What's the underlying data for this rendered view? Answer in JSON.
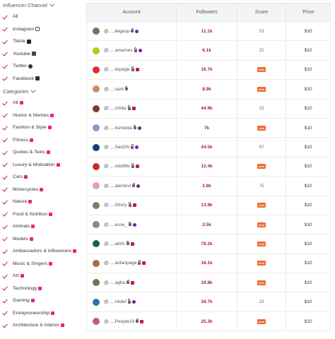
{
  "sidebar": {
    "influencer_channel": {
      "title": "Influencer Channel",
      "items": [
        {
          "label": "All",
          "icon": ""
        },
        {
          "label": "Instagram",
          "icon": "instagram-icon"
        },
        {
          "label": "Tiktok",
          "icon": "tiktok-icon"
        },
        {
          "label": "Youtube",
          "icon": "youtube-icon"
        },
        {
          "label": "Twitter",
          "icon": "twitter-icon"
        },
        {
          "label": "Facebook",
          "icon": "facebook-icon"
        }
      ]
    },
    "categories": {
      "title": "Categories",
      "items": [
        {
          "label": "All"
        },
        {
          "label": "Humor & Memes"
        },
        {
          "label": "Fashion & Style"
        },
        {
          "label": "Fitness"
        },
        {
          "label": "Quotes & Texts"
        },
        {
          "label": "Luxury & Motivation"
        },
        {
          "label": "Cars"
        },
        {
          "label": "Motorcycles"
        },
        {
          "label": "Nature"
        },
        {
          "label": "Food & Nutrition"
        },
        {
          "label": "Animals"
        },
        {
          "label": "Models"
        },
        {
          "label": "Ambassadors & Influencers"
        },
        {
          "label": "Music & Singers"
        },
        {
          "label": "Art"
        },
        {
          "label": "Technology"
        },
        {
          "label": "Gaming"
        },
        {
          "label": "Entrepreneurship"
        },
        {
          "label": "Architecture & Interior"
        }
      ]
    }
  },
  "table": {
    "headers": {
      "account": "Account",
      "followers": "Followers",
      "score": "Score",
      "price": "Price"
    },
    "new_label": "new",
    "rows": [
      {
        "account": "@.....llegasp",
        "followers": "11.1k",
        "score": "53",
        "price": "$10",
        "avatar_color": "#8a6a55",
        "icons": [
          "instagram",
          "twitter"
        ]
      },
      {
        "account": "@.....amemes",
        "followers": "6.1k",
        "score": "20",
        "price": "$10",
        "avatar_color": "#b8c820",
        "icons": [
          "instagram",
          "twitter"
        ]
      },
      {
        "account": "@.....itspage",
        "followers": "16.7k",
        "score": "new",
        "price": "$10",
        "avatar_color": "#d83030",
        "icons": [
          "instagram",
          "facebook"
        ]
      },
      {
        "account": "@.....sant",
        "followers": "8.9k",
        "score": "new",
        "price": "$10",
        "avatar_color": "#c09070",
        "icons": [
          "instagram"
        ]
      },
      {
        "account": "@.....rchita",
        "followers": "44.9k",
        "score": "25",
        "price": "$10",
        "avatar_color": "#704030",
        "icons": [
          "instagram",
          "facebook"
        ]
      },
      {
        "account": "@.....ksmedia",
        "followers": "7k",
        "score": "new",
        "price": "$10",
        "avatar_color": "#7a9fd0",
        "icons": [
          "instagram",
          "twitter"
        ]
      },
      {
        "account": "@.....SecDN",
        "followers": "44.5k",
        "score": "97",
        "price": "$10",
        "avatar_color": "#1a3a7a",
        "icons": [
          "instagram",
          "twitter"
        ]
      },
      {
        "account": "@.....ndoflife",
        "followers": "12.4k",
        "score": "new",
        "price": "$10",
        "avatar_color": "#c03030",
        "icons": [
          "instagram",
          "facebook"
        ]
      },
      {
        "account": "@.....alentino",
        "followers": "2.8k",
        "score": "75",
        "price": "$10",
        "avatar_color": "#e8a0b0",
        "icons": [
          "instagram",
          "twitter"
        ]
      },
      {
        "account": "@.....tStory",
        "followers": "13.8k",
        "score": "new",
        "price": "$10",
        "avatar_color": "#8a7a60",
        "icons": [
          "instagram",
          "facebook"
        ]
      },
      {
        "account": "@.....esse_",
        "followers": "2.5k",
        "score": "new",
        "price": "$10",
        "avatar_color": "#a08070",
        "icons": [
          "instagram",
          "twitter"
        ]
      },
      {
        "account": "@.....alnfo",
        "followers": "78.2k",
        "score": "new",
        "price": "$10",
        "avatar_color": "#206040",
        "icons": [
          "instagram",
          "facebook"
        ]
      },
      {
        "account": "@.....anfanpage",
        "followers": "16.1k",
        "score": "new",
        "price": "$10",
        "avatar_color": "#9a7050",
        "icons": [
          "instagram",
          "facebook"
        ]
      },
      {
        "account": "@.....agha",
        "followers": "19.8k",
        "score": "new",
        "price": "$10",
        "avatar_color": "#6a7a50",
        "icons": [
          "instagram",
          "facebook"
        ]
      },
      {
        "account": "@.....mldef",
        "followers": "34.7k",
        "score": "33",
        "price": "$10",
        "avatar_color": "#3070b0",
        "icons": [
          "instagram",
          "twitter"
        ]
      },
      {
        "account": "@.....People19",
        "followers": "25.3k",
        "score": "new",
        "price": "$10",
        "avatar_color": "#c05a90",
        "icons": [
          "instagram",
          "facebook"
        ]
      }
    ]
  },
  "colors": {
    "accent": "#c2185b",
    "followers": "#a0157a",
    "new_badge": "#f06a35",
    "twitter": "#7b1fa2",
    "facebook": "#c2185b"
  }
}
